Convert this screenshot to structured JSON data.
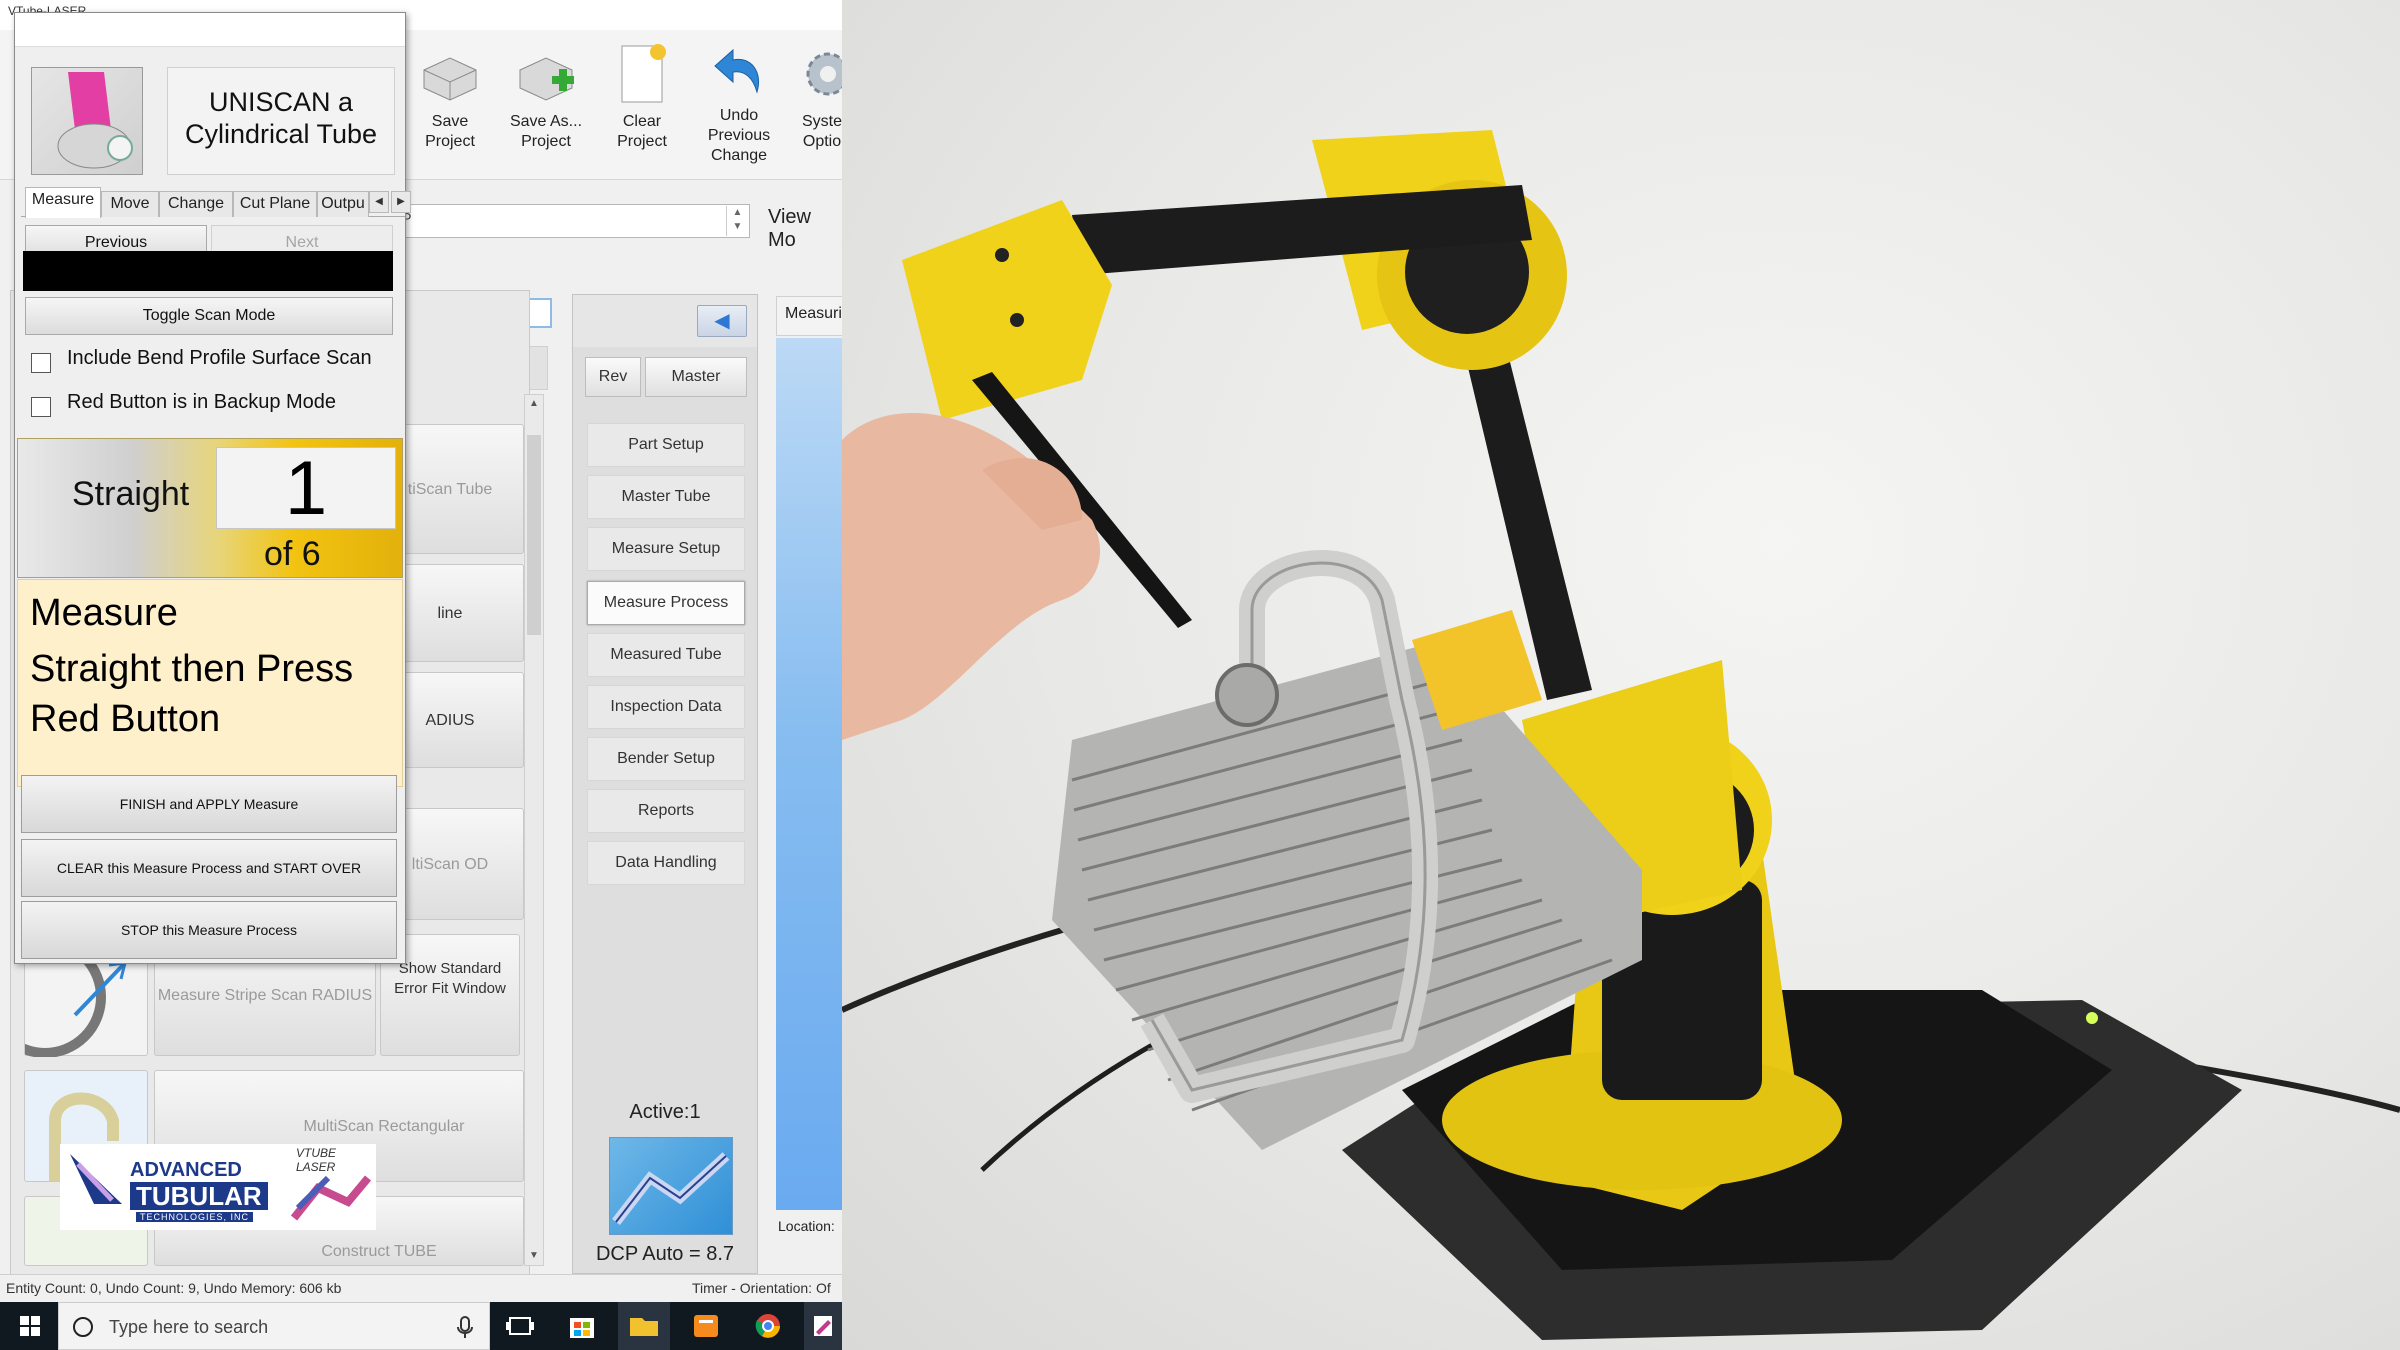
{
  "app": {
    "title": "VTube-LASER",
    "ribbon": [
      {
        "label_1": "Save",
        "label_2": "Project"
      },
      {
        "label_1": "Save As...",
        "label_2": "Project"
      },
      {
        "label_1": "Clear",
        "label_2": "Project"
      },
      {
        "label_1": "Undo",
        "label_2": "Previous",
        "label_3": "Change"
      },
      {
        "label_1": "Syste",
        "label_2": "Optio"
      }
    ],
    "combo_value": "P",
    "view_label": "View Mo"
  },
  "popup": {
    "title": "UNISCAN a Cylindrical Tube",
    "tabs": [
      "Measure",
      "Move",
      "Change",
      "Cut Plane",
      "Outpu"
    ],
    "active_tab": "Measure",
    "previous_label": "Previous",
    "next_label": "Next",
    "toggle_scan_label": "Toggle Scan Mode",
    "check_include_bend": "Include Bend Profile Surface Scan",
    "check_red_button": "Red Button is in Backup Mode",
    "straight_label": "Straight",
    "straight_count": "1",
    "of_label": "of 6",
    "instruction_l1": "Measure",
    "instruction_l2": "Straight then Press Red Button",
    "finish_label": "FINISH and APPLY Measure",
    "clear_label": "CLEAR this Measure Process and START OVER",
    "stop_label": "STOP this Measure Process"
  },
  "tools": {
    "multiscan_tube": "tiScan Tube",
    "line": "line",
    "radius": "ADIUS",
    "multiscan_od": "ltiScan OD",
    "stripe_scan": "Measure Stripe Scan RADIUS",
    "show_std_error": "Show Standard Error Fit Window",
    "multiscan_rect": "MultiScan Rectangular",
    "construct_tube": "Construct TUBE",
    "logo_atc_1": "ADVANCED",
    "logo_atc_2": "TUBULAR",
    "logo_atc_3": "TECHNOLOGIES, INC",
    "logo_vtube": "VTUBE LASER"
  },
  "nav": {
    "rev": "Rev",
    "master": "Master",
    "items": [
      "Part Setup",
      "Master Tube",
      "Measure Setup",
      "Measure Process",
      "Measured Tube",
      "Inspection Data",
      "Bender Setup",
      "Reports",
      "Data Handling"
    ],
    "active_item": "Measure Process",
    "active_text": "Active:1",
    "dcp_text": "DCP Auto = 8.7"
  },
  "preview": {
    "head": "Measuri",
    "location": "Location:"
  },
  "status": {
    "left": "Entity Count: 0, Undo Count: 9, Undo Memory: 606 kb",
    "right": "Timer - Orientation: Of"
  },
  "taskbar": {
    "search_placeholder": "Type here to search"
  },
  "colors": {
    "arm_yellow": "#f1d21b",
    "arm_black": "#1c1c1c",
    "panel_gold": "#f2c311",
    "instruction_bg": "#fff0cc"
  }
}
